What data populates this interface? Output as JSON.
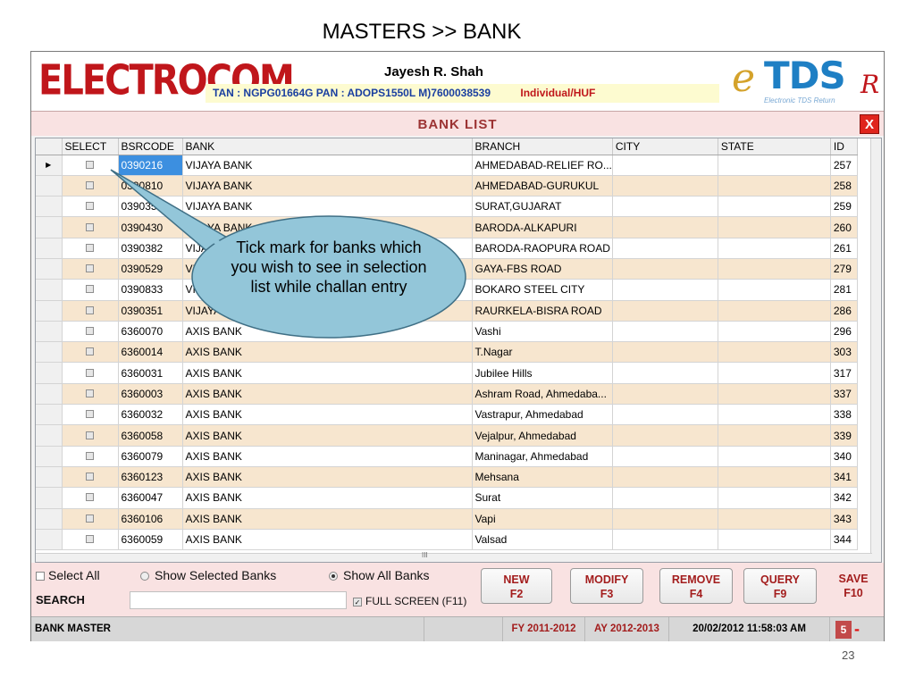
{
  "slide": {
    "title": "MASTERS >> BANK",
    "page_number": "23"
  },
  "header": {
    "logo_text": "ELECTROCOM",
    "user_name": "Jayesh R. Shah",
    "ids": "TAN : NGPG01664G  PAN : ADOPS1550L  M)7600038539",
    "entity_type": "Individual/HUF",
    "brand": {
      "e": "e",
      "tds": "TDS",
      "r": "R",
      "tagline": "Electronic TDS Return"
    }
  },
  "list": {
    "title": "BANK LIST",
    "close_label": "X",
    "columns": [
      "SELECT",
      "BSRCODE",
      "BANK",
      "BRANCH",
      "CITY",
      "STATE",
      "ID"
    ],
    "rows": [
      {
        "code": "0390216",
        "bank": "VIJAYA BANK",
        "branch": "AHMEDABAD-RELIEF RO...",
        "city": "",
        "state": "",
        "id": "257"
      },
      {
        "code": "0390810",
        "bank": "VIJAYA BANK",
        "branch": "AHMEDABAD-GURUKUL",
        "city": "",
        "state": "",
        "id": "258"
      },
      {
        "code": "0390353",
        "bank": "VIJAYA BANK",
        "branch": "SURAT,GUJARAT",
        "city": "",
        "state": "",
        "id": "259"
      },
      {
        "code": "0390430",
        "bank": "VIJAYA BANK",
        "branch": "BARODA-ALKAPURI",
        "city": "",
        "state": "",
        "id": "260"
      },
      {
        "code": "0390382",
        "bank": "VIJAYA BANK",
        "branch": "BARODA-RAOPURA ROAD",
        "city": "",
        "state": "",
        "id": "261"
      },
      {
        "code": "0390529",
        "bank": "VIJAYA BANK",
        "branch": "GAYA-FBS ROAD",
        "city": "",
        "state": "",
        "id": "279"
      },
      {
        "code": "0390833",
        "bank": "VIJAYA BANK",
        "branch": "BOKARO STEEL CITY",
        "city": "",
        "state": "",
        "id": "281"
      },
      {
        "code": "0390351",
        "bank": "VIJAYA BANK",
        "branch": "RAURKELA-BISRA ROAD",
        "city": "",
        "state": "",
        "id": "286"
      },
      {
        "code": "6360070",
        "bank": "AXIS BANK",
        "branch": "Vashi",
        "city": "",
        "state": "",
        "id": "296"
      },
      {
        "code": "6360014",
        "bank": "AXIS BANK",
        "branch": "T.Nagar",
        "city": "",
        "state": "",
        "id": "303"
      },
      {
        "code": "6360031",
        "bank": "AXIS BANK",
        "branch": "Jubilee Hills",
        "city": "",
        "state": "",
        "id": "317"
      },
      {
        "code": "6360003",
        "bank": "AXIS BANK",
        "branch": "Ashram Road, Ahmedaba...",
        "city": "",
        "state": "",
        "id": "337"
      },
      {
        "code": "6360032",
        "bank": "AXIS BANK",
        "branch": "Vastrapur, Ahmedabad",
        "city": "",
        "state": "",
        "id": "338"
      },
      {
        "code": "6360058",
        "bank": "AXIS BANK",
        "branch": "Vejalpur, Ahmedabad",
        "city": "",
        "state": "",
        "id": "339"
      },
      {
        "code": "6360079",
        "bank": "AXIS BANK",
        "branch": "Maninagar, Ahmedabad",
        "city": "",
        "state": "",
        "id": "340"
      },
      {
        "code": "6360123",
        "bank": "AXIS BANK",
        "branch": "Mehsana",
        "city": "",
        "state": "",
        "id": "341"
      },
      {
        "code": "6360047",
        "bank": "AXIS BANK",
        "branch": "Surat",
        "city": "",
        "state": "",
        "id": "342"
      },
      {
        "code": "6360106",
        "bank": "AXIS BANK",
        "branch": "Vapi",
        "city": "",
        "state": "",
        "id": "343"
      },
      {
        "code": "6360059",
        "bank": "AXIS BANK",
        "branch": "Valsad",
        "city": "",
        "state": "",
        "id": "344"
      }
    ],
    "scroll_mark": "III"
  },
  "callout": {
    "text": "Tick mark for banks which you wish to see in selection list while challan entry"
  },
  "bottom": {
    "select_all": "Select All",
    "show_selected": "Show Selected Banks",
    "show_all": "Show All Banks",
    "search_label": "SEARCH",
    "search_value": "",
    "full_screen": "FULL SCREEN (F11)",
    "buttons": [
      {
        "l1": "NEW",
        "l2": "F2"
      },
      {
        "l1": "MODIFY",
        "l2": "F3"
      },
      {
        "l1": "REMOVE",
        "l2": "F4"
      },
      {
        "l1": "QUERY",
        "l2": "F9"
      },
      {
        "l1": "SAVE",
        "l2": "F10"
      }
    ]
  },
  "status": {
    "module": "BANK MASTER",
    "fy": "FY 2011-2012",
    "ay": "AY 2012-2013",
    "datetime": "20/02/2012 11:58:03 AM",
    "count": "5",
    "minus": "-"
  }
}
